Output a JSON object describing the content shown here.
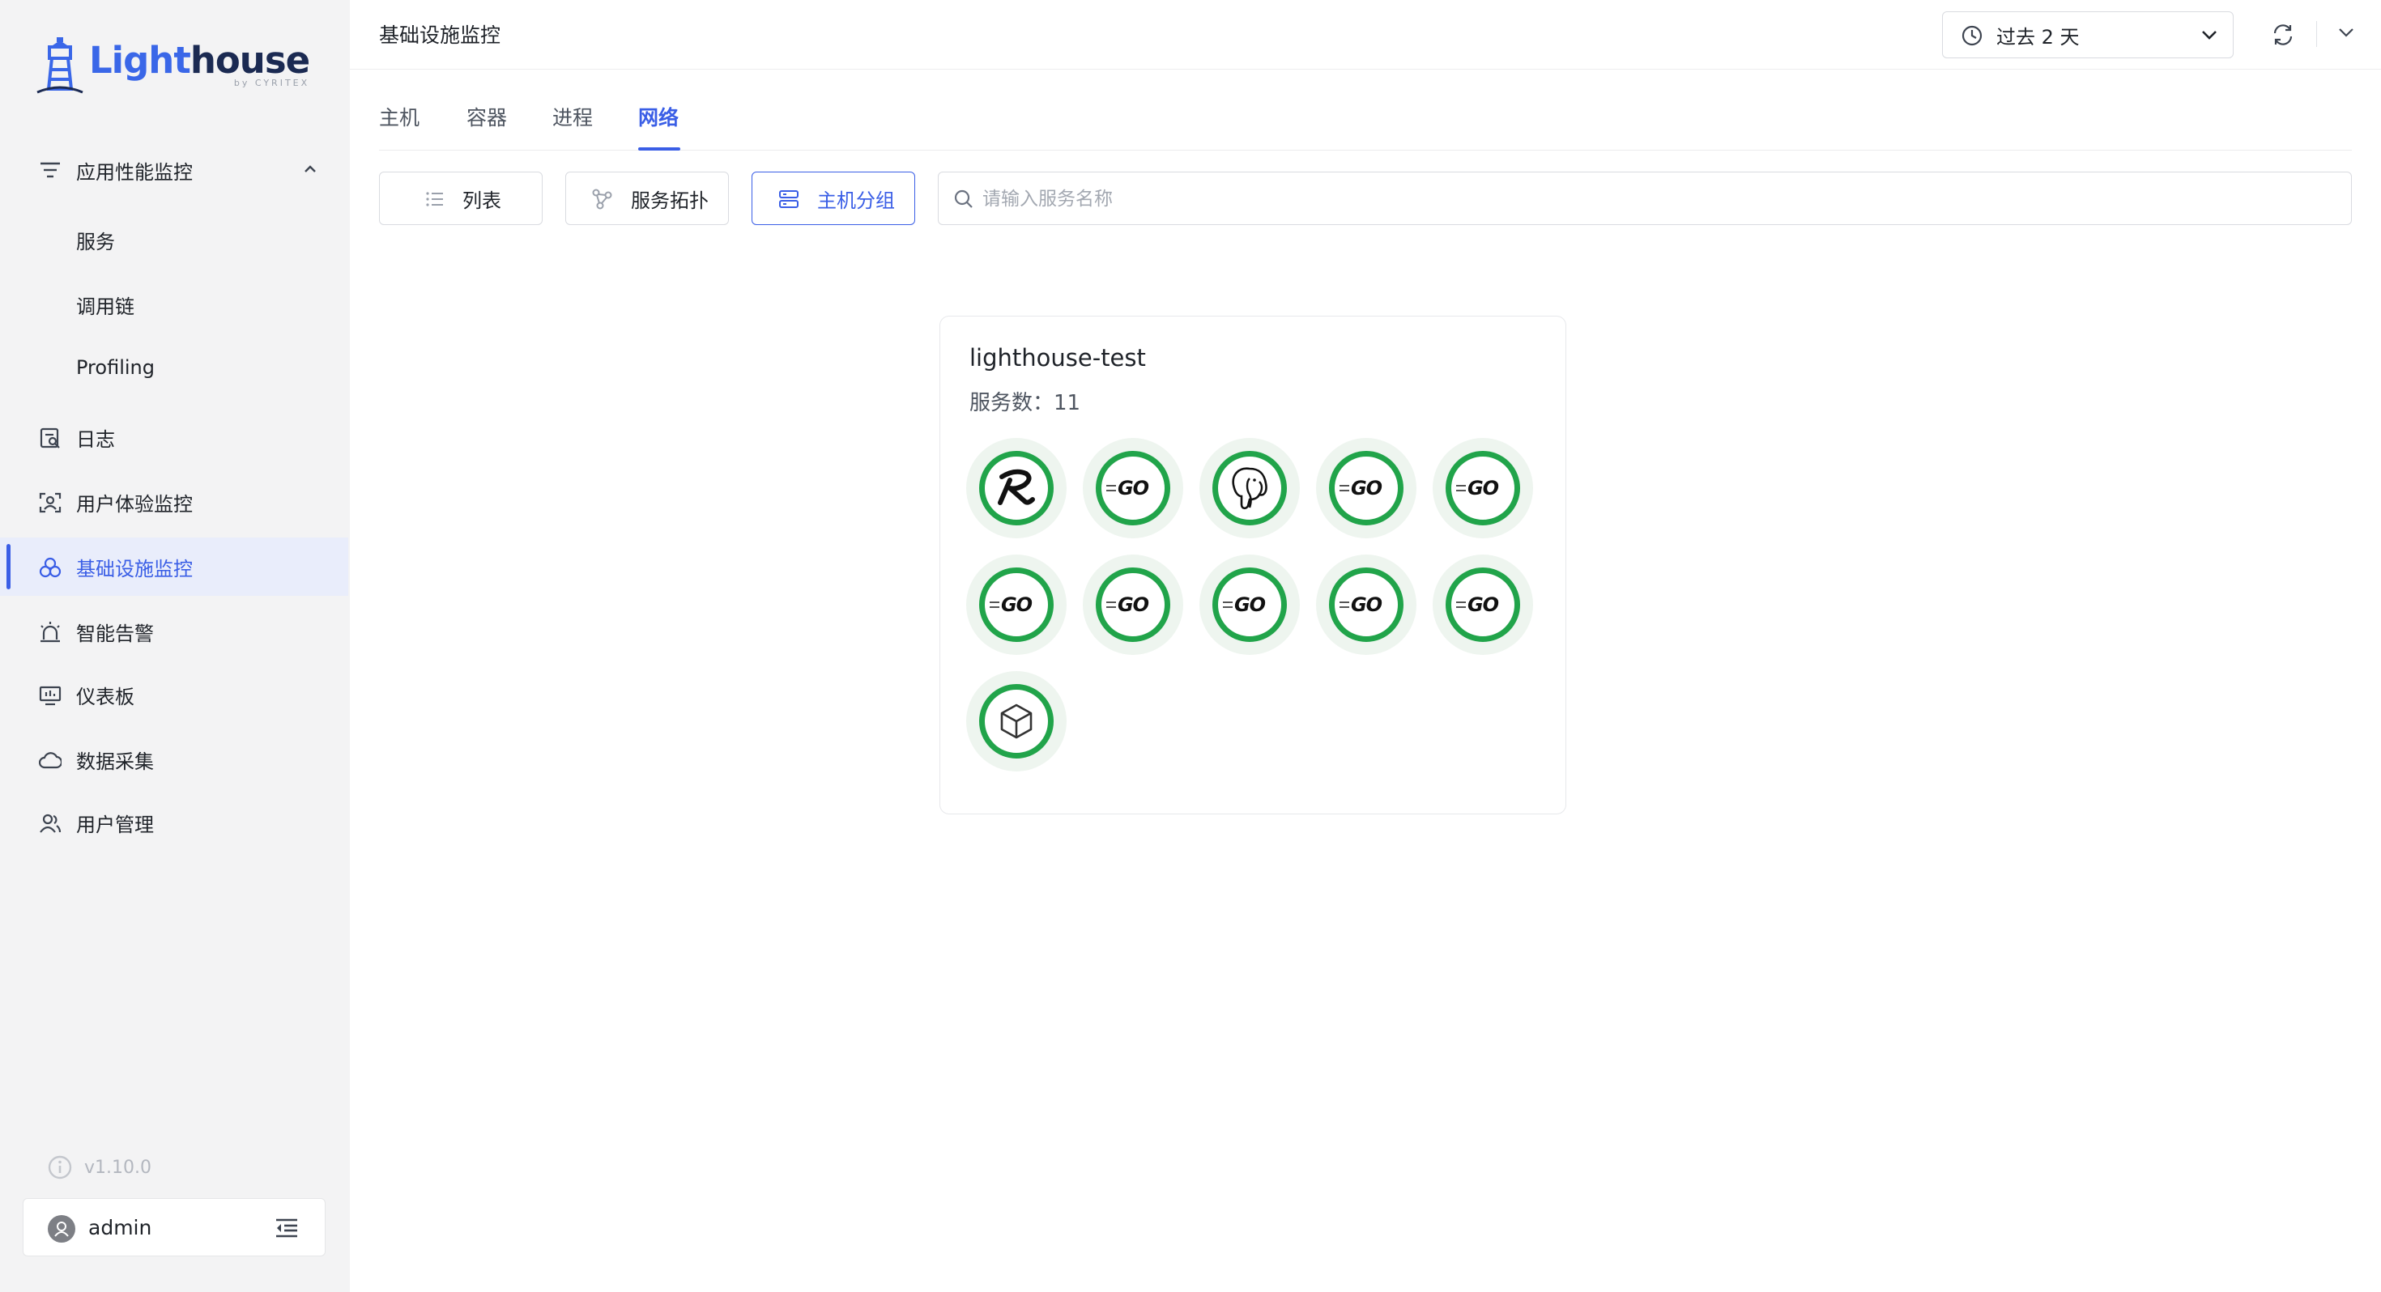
{
  "logo": {
    "word_a": "Light",
    "word_b": "house",
    "sub": "by CYRITEX"
  },
  "sidebar": {
    "items": [
      {
        "label": "应用性能监控",
        "icon": "apm-filter-icon",
        "expanded": true
      },
      {
        "label": "服务",
        "sub": true
      },
      {
        "label": "调用链",
        "sub": true
      },
      {
        "label": "Profiling",
        "sub": true
      },
      {
        "label": "日志",
        "icon": "log-icon"
      },
      {
        "label": "用户体验监控",
        "icon": "user-experience-icon"
      },
      {
        "label": "基础设施监控",
        "icon": "infrastructure-icon",
        "active": true
      },
      {
        "label": "智能告警",
        "icon": "alarm-icon"
      },
      {
        "label": "仪表板",
        "icon": "dashboard-icon"
      },
      {
        "label": "数据采集",
        "icon": "cloud-collect-icon"
      },
      {
        "label": "用户管理",
        "icon": "users-icon"
      }
    ],
    "version": "v1.10.0",
    "user": "admin"
  },
  "header": {
    "title": "基础设施监控",
    "time_range": "过去 2 天"
  },
  "tabs": [
    {
      "label": "主机"
    },
    {
      "label": "容器"
    },
    {
      "label": "进程"
    },
    {
      "label": "网络",
      "active": true
    }
  ],
  "toolbar": {
    "list_label": "列表",
    "topology_label": "服务拓扑",
    "host_group_label": "主机分组",
    "search_placeholder": "请输入服务名称"
  },
  "host_card": {
    "name": "lighthouse-test",
    "count_label": "服务数：11",
    "services": [
      {
        "icon": "rust-icon"
      },
      {
        "icon": "go-icon"
      },
      {
        "icon": "postgresql-icon"
      },
      {
        "icon": "go-icon"
      },
      {
        "icon": "go-icon"
      },
      {
        "icon": "go-icon"
      },
      {
        "icon": "go-icon"
      },
      {
        "icon": "go-icon"
      },
      {
        "icon": "go-icon"
      },
      {
        "icon": "go-icon"
      },
      {
        "icon": "box-icon"
      }
    ]
  },
  "colors": {
    "accent": "#3a5ee6",
    "ring": "#21a44a",
    "ring_bg": "#eef5ef"
  }
}
